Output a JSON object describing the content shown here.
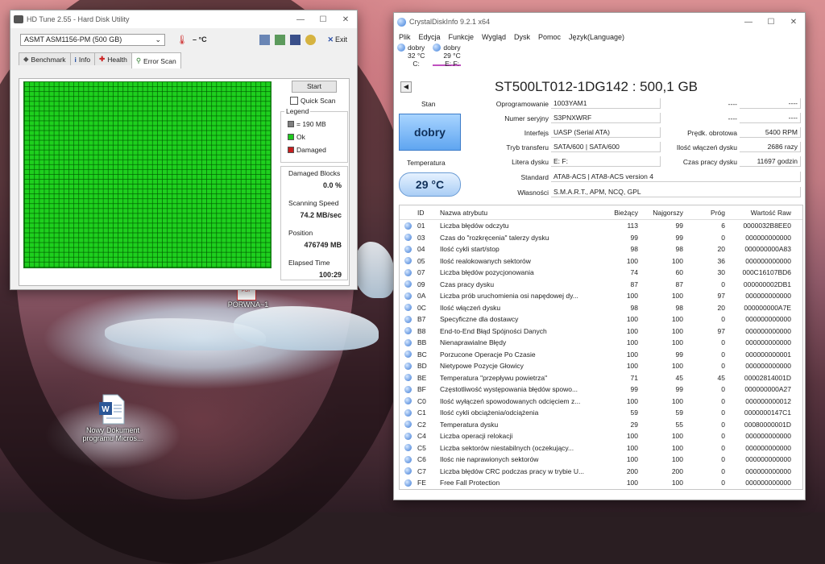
{
  "hdtune": {
    "title": "HD Tune 2.55 - Hard Disk Utility",
    "drive": "ASMT    ASM1156-PM (500 GB)",
    "temp": "– °C",
    "exit": "Exit",
    "tabs": [
      "Benchmark",
      "Info",
      "Health",
      "Error Scan"
    ],
    "start": "Start",
    "quick_scan": "Quick Scan",
    "legend_title": "Legend",
    "legend": [
      {
        "label": "= 190 MB",
        "color": "#7f7f7f"
      },
      {
        "label": "Ok",
        "color": "#1ec81e"
      },
      {
        "label": "Damaged",
        "color": "#c81e1e"
      }
    ],
    "stats": [
      {
        "label": "Damaged Blocks",
        "value": "0.0 %"
      },
      {
        "label": "Scanning Speed",
        "value": "74.2 MB/sec"
      },
      {
        "label": "Position",
        "value": "476749 MB"
      },
      {
        "label": "Elapsed Time",
        "value": "100:29"
      }
    ]
  },
  "cdi": {
    "title": "CrystalDiskInfo 9.2.1 x64",
    "menu": [
      "Plik",
      "Edycja",
      "Funkcje",
      "Wygląd",
      "Dysk",
      "Pomoc",
      "Język(Language)"
    ],
    "drives": [
      {
        "status": "dobry",
        "temp": "32 °C",
        "letter": "C:"
      },
      {
        "status": "dobry",
        "temp": "29 °C",
        "letter": "E: F:"
      }
    ],
    "model": "ST500LT012-1DG142 : 500,1 GB",
    "stan_label": "Stan",
    "stan_value": "dobry",
    "temp_label": "Temperatura",
    "temp_value": "29 °C",
    "left_fields": [
      {
        "label": "Oprogramowanie",
        "value": "1003YAM1"
      },
      {
        "label": "Numer seryjny",
        "value": "S3PNXWRF"
      },
      {
        "label": "Interfejs",
        "value": "UASP (Serial ATA)"
      },
      {
        "label": "Tryb transferu",
        "value": "SATA/600 | SATA/600"
      },
      {
        "label": "Litera dysku",
        "value": "E: F:"
      }
    ],
    "right_fields": [
      {
        "label": "----",
        "value": "----"
      },
      {
        "label": "----",
        "value": "----"
      },
      {
        "label": "Prędk. obrotowa",
        "value": "5400 RPM"
      },
      {
        "label": "Ilość włączeń dysku",
        "value": "2686 razy"
      },
      {
        "label": "Czas pracy dysku",
        "value": "11697 godzin"
      }
    ],
    "standard_label": "Standard",
    "standard_value": "ATA8-ACS | ATA8-ACS version 4",
    "features_label": "Własności",
    "features_value": "S.M.A.R.T., APM, NCQ, GPL",
    "columns": [
      "ID",
      "Nazwa atrybutu",
      "Bieżący",
      "Najgorszy",
      "Próg",
      "Wartość Raw"
    ],
    "rows": [
      [
        "01",
        "Liczba błędów odczytu",
        "113",
        "99",
        "6",
        "0000032B8EE0"
      ],
      [
        "03",
        "Czas do \"rozkręcenia\" talerzy dysku",
        "99",
        "99",
        "0",
        "000000000000"
      ],
      [
        "04",
        "Ilość cykli start/stop",
        "98",
        "98",
        "20",
        "000000000A83"
      ],
      [
        "05",
        "Ilość realokowanych sektorów",
        "100",
        "100",
        "36",
        "000000000000"
      ],
      [
        "07",
        "Liczba błędów pozycjonowania",
        "74",
        "60",
        "30",
        "000C16107BD6"
      ],
      [
        "09",
        "Czas pracy dysku",
        "87",
        "87",
        "0",
        "000000002DB1"
      ],
      [
        "0A",
        "Liczba prób uruchomienia osi napędowej dy...",
        "100",
        "100",
        "97",
        "000000000000"
      ],
      [
        "0C",
        "Ilość włączeń dysku",
        "98",
        "98",
        "20",
        "000000000A7E"
      ],
      [
        "B7",
        "Specyficzne dla dostawcy",
        "100",
        "100",
        "0",
        "000000000000"
      ],
      [
        "B8",
        "End-to-End Błąd Spójności Danych",
        "100",
        "100",
        "97",
        "000000000000"
      ],
      [
        "BB",
        "Nienaprawialne Błędy",
        "100",
        "100",
        "0",
        "000000000000"
      ],
      [
        "BC",
        "Porzucone Operacje Po Czasie",
        "100",
        "99",
        "0",
        "000000000001"
      ],
      [
        "BD",
        "Nietypowe Pozycje Głowicy",
        "100",
        "100",
        "0",
        "000000000000"
      ],
      [
        "BE",
        "Temperatura \"przepływu powietrza\"",
        "71",
        "45",
        "45",
        "00002814001D"
      ],
      [
        "BF",
        "Częstotliwość występowania błędów spowo...",
        "99",
        "99",
        "0",
        "000000000A27"
      ],
      [
        "C0",
        "Ilość wyłączeń spowodowanych odcięciem z...",
        "100",
        "100",
        "0",
        "000000000012"
      ],
      [
        "C1",
        "Ilość cykli obciążenia/odciążenia",
        "59",
        "59",
        "0",
        "0000000147C1"
      ],
      [
        "C2",
        "Temperatura dysku",
        "29",
        "55",
        "0",
        "00080000001D"
      ],
      [
        "C4",
        "Liczba operacji relokacji",
        "100",
        "100",
        "0",
        "000000000000"
      ],
      [
        "C5",
        "Liczba sektorów niestabilnych (oczekujący...",
        "100",
        "100",
        "0",
        "000000000000"
      ],
      [
        "C6",
        "Ilośc nie naprawionych sektorów",
        "100",
        "100",
        "0",
        "000000000000"
      ],
      [
        "C7",
        "Liczba błędów CRC podczas pracy w trybie U...",
        "200",
        "200",
        "0",
        "000000000000"
      ],
      [
        "FE",
        "Free Fall Protection",
        "100",
        "100",
        "0",
        "000000000000"
      ]
    ]
  },
  "desktop": {
    "pdf_label": "PORWNA~1",
    "doc_label": "Nowy Dokument programu Micros..."
  }
}
